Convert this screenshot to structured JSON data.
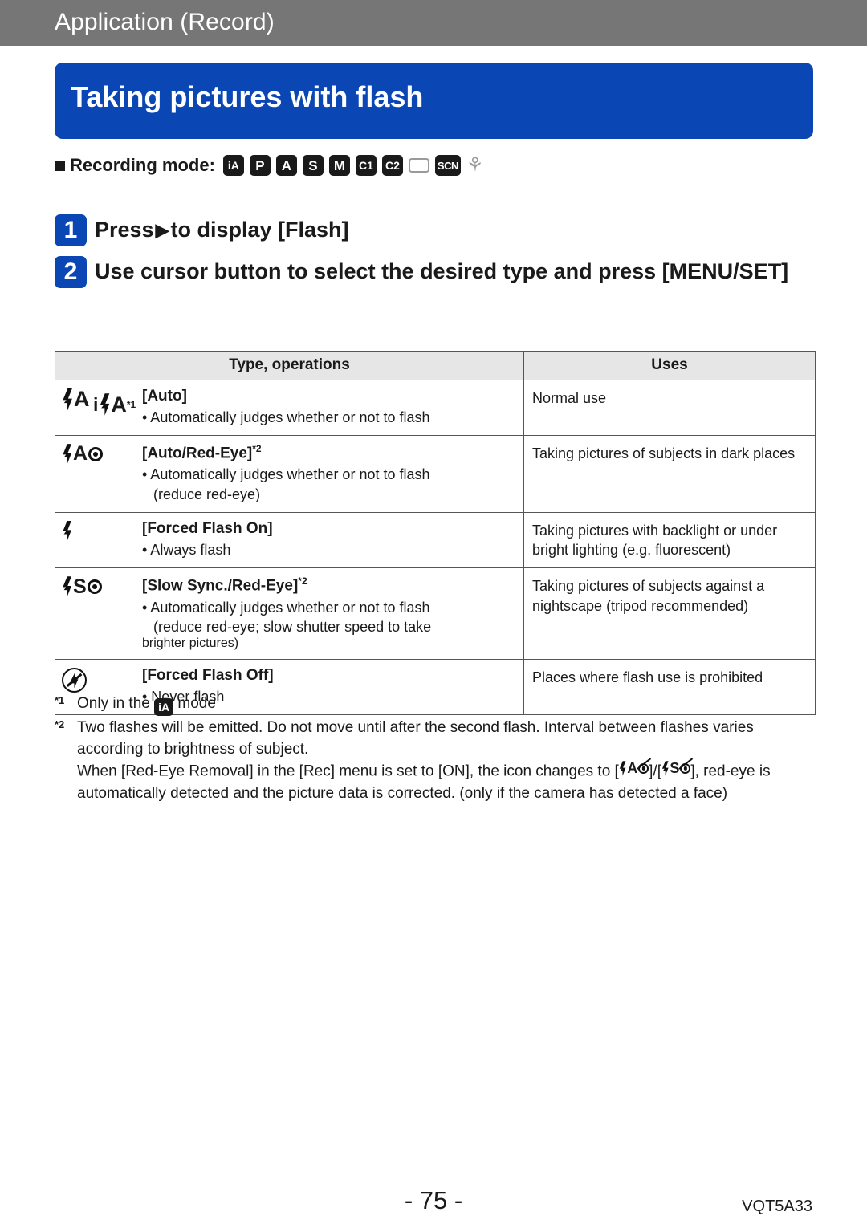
{
  "header": {
    "chapter": "Application (Record)",
    "title": "Taking pictures with flash"
  },
  "recording_mode": {
    "label": "Recording mode:",
    "icons": [
      {
        "name": "mode-ia",
        "text": "iA",
        "style": "chip-small"
      },
      {
        "name": "mode-p",
        "text": "P",
        "style": "chip"
      },
      {
        "name": "mode-a",
        "text": "A",
        "style": "chip"
      },
      {
        "name": "mode-s",
        "text": "S",
        "style": "chip"
      },
      {
        "name": "mode-m",
        "text": "M",
        "style": "chip"
      },
      {
        "name": "mode-c1",
        "text": "C1",
        "style": "chip-small"
      },
      {
        "name": "mode-c2",
        "text": "C2",
        "style": "chip-small"
      },
      {
        "name": "mode-panorama",
        "text": "",
        "style": "outline"
      },
      {
        "name": "mode-scn",
        "text": "SCN",
        "style": "chip-scn"
      },
      {
        "name": "mode-creative",
        "text": "",
        "style": "fish"
      }
    ]
  },
  "steps": [
    {
      "num": "1",
      "text_before": "Press",
      "text_after": "to display [Flash]",
      "has_arrow": true
    },
    {
      "num": "2",
      "text_before": "Use cursor button to select the desired type and press [MENU/SET]",
      "text_after": "",
      "has_arrow": false
    }
  ],
  "table": {
    "headers": [
      "Type, operations",
      "Uses"
    ],
    "rows": [
      {
        "icons": [
          "flash-auto",
          "intelligent-flash-auto"
        ],
        "icon_note": "*1",
        "title": "[Auto]",
        "title_note": "",
        "lines": [
          "• Automatically judges whether or not to flash"
        ],
        "cont": [],
        "uses": "Normal use"
      },
      {
        "icons": [
          "flash-auto-redeye"
        ],
        "icon_note": "",
        "title": "[Auto/Red-Eye]",
        "title_note": "*2",
        "lines": [
          "• Automatically judges whether or not to flash"
        ],
        "cont": [
          "(reduce red-eye)"
        ],
        "uses": "Taking pictures of subjects in dark places"
      },
      {
        "icons": [
          "flash-forced-on"
        ],
        "icon_note": "",
        "title": "[Forced Flash On]",
        "title_note": "",
        "lines": [
          "• Always flash"
        ],
        "cont": [],
        "uses": "Taking pictures with backlight or under bright lighting (e.g. fluorescent)"
      },
      {
        "icons": [
          "flash-slow-sync-redeye"
        ],
        "icon_note": "",
        "title": "[Slow Sync./Red-Eye]",
        "title_note": "*2",
        "lines": [
          "• Automatically judges whether or not to flash"
        ],
        "cont": [
          "(reduce red-eye; slow shutter speed to take",
          "brighter pictures)"
        ],
        "uses": "Taking pictures of subjects against a nightscape (tripod recommended)"
      },
      {
        "icons": [
          "flash-forced-off"
        ],
        "icon_note": "",
        "title": "[Forced Flash Off]",
        "title_note": "",
        "lines": [
          "• Never flash"
        ],
        "cont": [],
        "uses": "Places where flash use is prohibited"
      }
    ]
  },
  "footnotes": {
    "note1_mark": "*1",
    "note1_before": "Only in the",
    "note1_chip": "iA",
    "note1_after": "mode",
    "note2_mark": "*2",
    "note2_para1": "Two flashes will be emitted. Do not move until after the second flash. Interval between flashes varies according to brightness of subject.",
    "note2_para2_before": "When [Red-Eye Removal] in the [Rec] menu is set to [ON], the icon changes to [",
    "note2_para2_middle": "]/[",
    "note2_para2_after": "], red-eye is automatically detected and the picture data is corrected. (only if the camera has detected a face)"
  },
  "footer": {
    "page": "- 75 -",
    "code": "VQT5A33"
  },
  "colors": {
    "chapter_bar": "#767676",
    "title_block": "#0a46b4",
    "table_header": "#e6e6e6",
    "text": "#1a1a1a"
  }
}
